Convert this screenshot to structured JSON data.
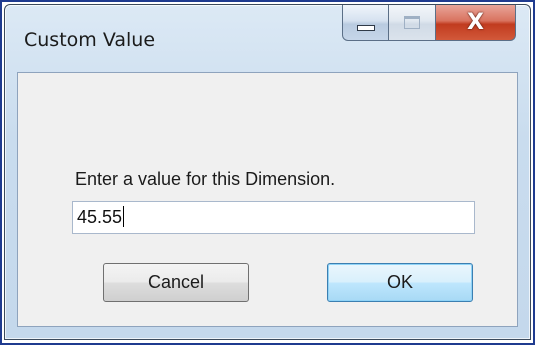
{
  "window": {
    "title": "Custom Value",
    "close_glyph": "X"
  },
  "dialog": {
    "prompt": "Enter a value for this Dimension.",
    "input_value": "45.55",
    "cancel_label": "Cancel",
    "ok_label": "OK"
  },
  "icons": {
    "minimize": "minimize-icon",
    "maximize": "maximize-icon",
    "close": "close-icon"
  },
  "colors": {
    "frame_border": "#1f3b8f",
    "close_button": "#c13b1f",
    "ok_button_border": "#3c7fb1"
  }
}
